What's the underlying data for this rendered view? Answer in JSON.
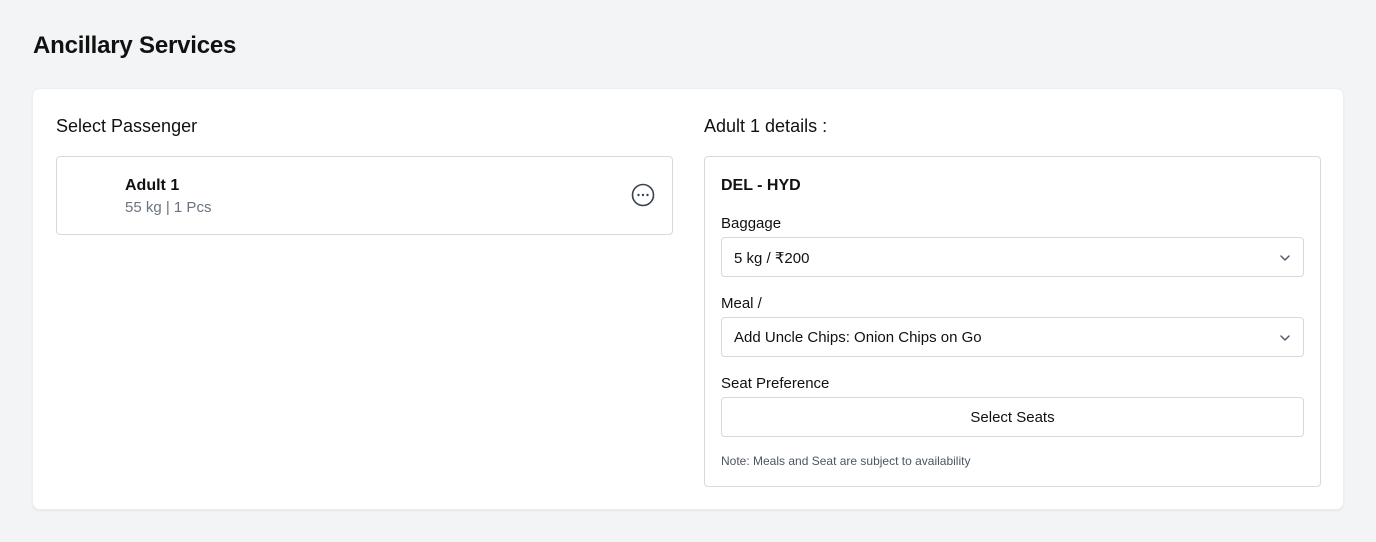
{
  "page": {
    "title": "Ancillary Services"
  },
  "passengers": {
    "section_title": "Select Passenger",
    "items": [
      {
        "name": "Adult 1",
        "meta": "55 kg | 1 Pcs"
      }
    ]
  },
  "details": {
    "section_title": "Adult 1 details :",
    "route": "DEL - HYD",
    "baggage": {
      "label": "Baggage",
      "value": "5 kg / ₹200"
    },
    "meal": {
      "label": "Meal /",
      "value": "Add Uncle Chips: Onion Chips on Go"
    },
    "seat": {
      "label": "Seat Preference",
      "button_label": "Select Seats"
    },
    "note": "Note: Meals and Seat are subject to availability"
  },
  "icons": {
    "more": "more-options-icon",
    "chevron": "chevron-down-icon"
  },
  "colors": {
    "background": "#f3f4f6",
    "card": "#ffffff",
    "border": "#d6d9de",
    "muted_text": "#6b7280"
  }
}
